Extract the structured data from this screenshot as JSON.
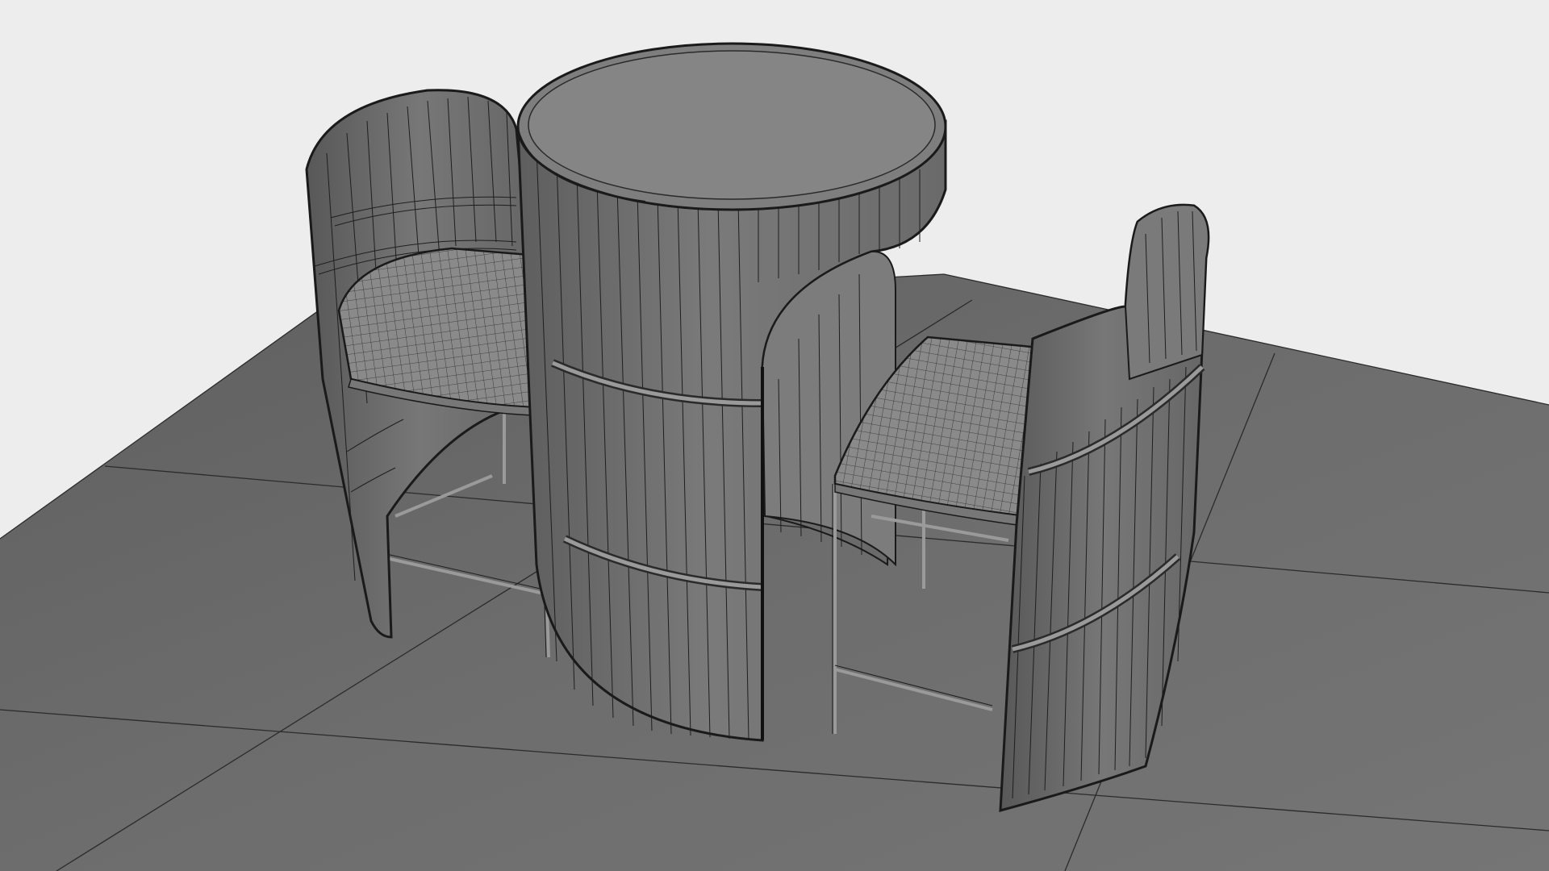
{
  "viewport": {
    "mode": "wireframe-on-shaded",
    "projection": "perspective",
    "background_color": "#ededed",
    "ground_color": "#6c6c6c",
    "wire_color": "#1a1a1a",
    "mesh_fill_color": "#707070",
    "seat_fill_color": "#858585",
    "frame_color": "#8a8a8a"
  },
  "scene": {
    "ground_plane": {
      "grid": true
    },
    "objects": [
      {
        "name": "round-bar-table",
        "type": "cylinder"
      },
      {
        "name": "bar-stool-left",
        "type": "stool"
      },
      {
        "name": "bar-stool-right",
        "type": "stool"
      }
    ]
  }
}
